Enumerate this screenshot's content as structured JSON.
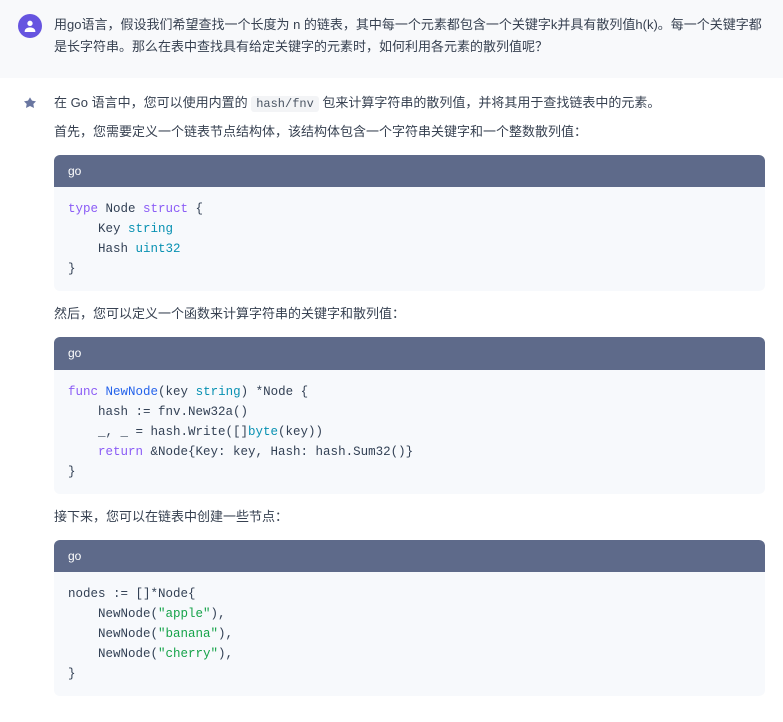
{
  "user": {
    "question_line1": "用go语言，假设我们希望查找一个长度为 n 的链表，其中每一个元素都包含一个关键字k并具有散列值h(k)。每一个关键字都",
    "question_line2": "是长字符串。那么在表中查找具有给定关键字的元素时，如何利用各元素的散列值呢？"
  },
  "ai": {
    "intro_part1": "在 Go 语言中，您可以使用内置的 ",
    "intro_inline_code": "hash/fnv",
    "intro_part2": " 包来计算字符串的散列值，并将其用于查找链表中的元素。",
    "intro_line2": "首先，您需要定义一个链表节点结构体，该结构体包含一个字符串关键字和一个整数散列值：",
    "paragraph2": "然后，您可以定义一个函数来计算字符串的关键字和散列值：",
    "paragraph3": "接下来，您可以在链表中创建一些节点：",
    "code_lang": "go",
    "code1": {
      "tokens": [
        {
          "t": "type",
          "c": "kw"
        },
        {
          "t": " Node ",
          "c": ""
        },
        {
          "t": "struct",
          "c": "kw"
        },
        {
          "t": " {\n",
          "c": ""
        },
        {
          "t": "    Key ",
          "c": ""
        },
        {
          "t": "string",
          "c": "typ"
        },
        {
          "t": "\n",
          "c": ""
        },
        {
          "t": "    Hash ",
          "c": ""
        },
        {
          "t": "uint32",
          "c": "typ"
        },
        {
          "t": "\n",
          "c": ""
        },
        {
          "t": "}",
          "c": ""
        }
      ]
    },
    "code2": {
      "tokens": [
        {
          "t": "func",
          "c": "kw"
        },
        {
          "t": " ",
          "c": ""
        },
        {
          "t": "NewNode",
          "c": "fn"
        },
        {
          "t": "(key ",
          "c": ""
        },
        {
          "t": "string",
          "c": "typ"
        },
        {
          "t": ") *Node {\n",
          "c": ""
        },
        {
          "t": "    hash := fnv.New32a()\n",
          "c": ""
        },
        {
          "t": "    _, _ = hash.Write([]",
          "c": ""
        },
        {
          "t": "byte",
          "c": "typ"
        },
        {
          "t": "(key))\n",
          "c": ""
        },
        {
          "t": "    ",
          "c": ""
        },
        {
          "t": "return",
          "c": "kw"
        },
        {
          "t": " &Node{Key: key, Hash: hash.Sum32()}\n",
          "c": ""
        },
        {
          "t": "}",
          "c": ""
        }
      ]
    },
    "code3": {
      "tokens": [
        {
          "t": "nodes := []*Node{\n",
          "c": ""
        },
        {
          "t": "    NewNode(",
          "c": ""
        },
        {
          "t": "\"apple\"",
          "c": "str"
        },
        {
          "t": "),\n",
          "c": ""
        },
        {
          "t": "    NewNode(",
          "c": ""
        },
        {
          "t": "\"banana\"",
          "c": "str"
        },
        {
          "t": "),\n",
          "c": ""
        },
        {
          "t": "    NewNode(",
          "c": ""
        },
        {
          "t": "\"cherry\"",
          "c": "str"
        },
        {
          "t": "),\n",
          "c": ""
        },
        {
          "t": "}",
          "c": ""
        }
      ]
    }
  }
}
